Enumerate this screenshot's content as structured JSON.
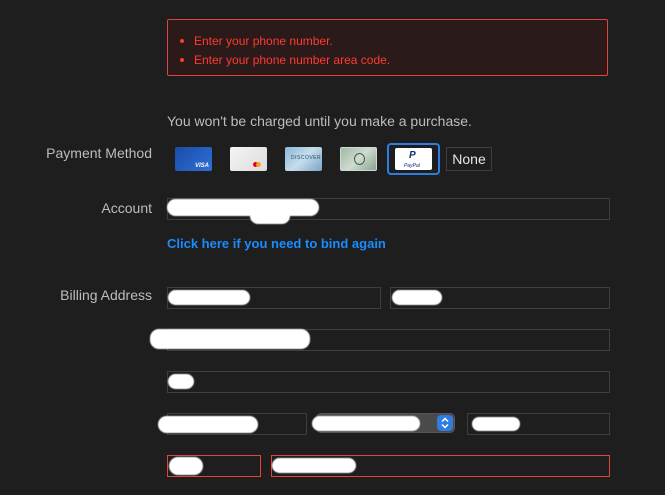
{
  "errors": {
    "items": [
      "Enter your phone number.",
      "Enter your phone number area code."
    ],
    "color": "#ff3b30"
  },
  "notice": "You won't be charged until you make a purchase.",
  "payment": {
    "label": "Payment Method",
    "cards": [
      {
        "name": "visa",
        "text": "VISA"
      },
      {
        "name": "mastercard",
        "text": ""
      },
      {
        "name": "discover",
        "text": "DISCOVER"
      },
      {
        "name": "amex",
        "text": ""
      },
      {
        "name": "paypal",
        "text": "PayPal",
        "selected": true
      }
    ],
    "none_label": "None",
    "selected_color": "#2f7de1"
  },
  "account": {
    "label": "Account",
    "value": "",
    "rebind_link": "Click here if you need to bind again",
    "link_color": "#1a8cff"
  },
  "billing": {
    "label": "Billing Address",
    "first_name": "",
    "last_name": "",
    "street": "",
    "street2": "",
    "city": "",
    "state": "",
    "zip": "",
    "area_code": "",
    "phone": "",
    "error_border_color": "#e0443a"
  }
}
